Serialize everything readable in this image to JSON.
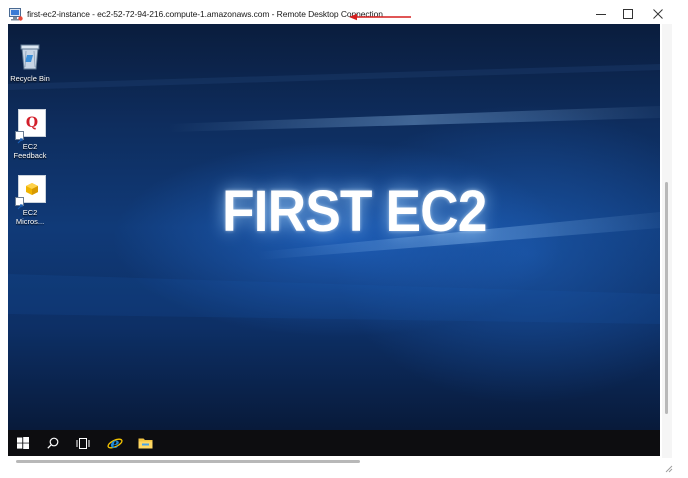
{
  "window": {
    "title": "first-ec2-instance - ec2-52-72-94-216.compute-1.amazonaws.com - Remote Desktop Connection",
    "app_icon": "remote-desktop-icon",
    "annotation_arrow_color": "#d61f1f",
    "controls": {
      "minimize": "minimize-icon",
      "maximize": "maximize-icon",
      "close": "close-icon"
    }
  },
  "desktop": {
    "wallpaper_text": "FIRST EC2",
    "icons": [
      {
        "label": "Recycle Bin",
        "icon": "recycle-bin-icon"
      },
      {
        "label": "EC2\nFeedback",
        "icon": "ec2-feedback-icon"
      },
      {
        "label": "EC2\nMicros...",
        "icon": "ec2-microsoft-icon"
      }
    ]
  },
  "taskbar": {
    "items": [
      {
        "name": "start",
        "icon": "windows-start-icon"
      },
      {
        "name": "search",
        "icon": "search-icon"
      },
      {
        "name": "task-view",
        "icon": "task-view-icon"
      },
      {
        "name": "internet-explorer",
        "icon": "internet-explorer-icon"
      },
      {
        "name": "file-explorer",
        "icon": "folder-icon"
      }
    ]
  },
  "colors": {
    "wallpaper_dark": "#081a3a",
    "wallpaper_light": "#1f6fd6",
    "taskbar": "#0d0d10",
    "tile_q": "#d21f2a",
    "tile_box": "#f0b400"
  }
}
